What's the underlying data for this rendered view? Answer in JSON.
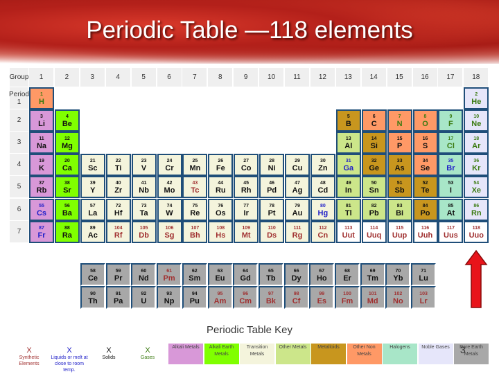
{
  "title": "Periodic Table —118 elements",
  "group_label": "Group",
  "period_label": "Period",
  "groups": [
    "1",
    "2",
    "3",
    "4",
    "5",
    "6",
    "7",
    "8",
    "9",
    "10",
    "11",
    "12",
    "13",
    "14",
    "15",
    "16",
    "17",
    "18"
  ],
  "periods": [
    "1",
    "2",
    "3",
    "4",
    "5",
    "6",
    "7"
  ],
  "colors": {
    "alkali-metal": "#d898d8",
    "alkaline-earth": "#80ff00",
    "transition": "#f4f4dc",
    "other-metal": "#cce68a",
    "metalloid": "#c8961e",
    "other-nonmetal": "#ff9966",
    "halogen": "#a8e6c8",
    "noble-gas": "#e6e6fa",
    "rare-earth": "#a8a8a8",
    "unknown": "#ffffff"
  },
  "state_colors": {
    "solid": "#111111",
    "liquid": "#2020c8",
    "gas": "#3a7a10",
    "synthetic": "#a03030"
  },
  "elements": [
    [
      1,
      "H",
      1,
      1,
      "other-nonmetal",
      "gas"
    ],
    [
      2,
      "He",
      1,
      18,
      "noble-gas",
      "gas"
    ],
    [
      3,
      "Li",
      2,
      1,
      "alkali-metal",
      "solid"
    ],
    [
      4,
      "Be",
      2,
      2,
      "alkaline-earth",
      "solid"
    ],
    [
      5,
      "B",
      2,
      13,
      "metalloid",
      "solid"
    ],
    [
      6,
      "C",
      2,
      14,
      "other-nonmetal",
      "solid"
    ],
    [
      7,
      "N",
      2,
      15,
      "other-nonmetal",
      "gas"
    ],
    [
      8,
      "O",
      2,
      16,
      "other-nonmetal",
      "gas"
    ],
    [
      9,
      "F",
      2,
      17,
      "halogen",
      "gas"
    ],
    [
      10,
      "Ne",
      2,
      18,
      "noble-gas",
      "gas"
    ],
    [
      11,
      "Na",
      3,
      1,
      "alkali-metal",
      "solid"
    ],
    [
      12,
      "Mg",
      3,
      2,
      "alkaline-earth",
      "solid"
    ],
    [
      13,
      "Al",
      3,
      13,
      "other-metal",
      "solid"
    ],
    [
      14,
      "Si",
      3,
      14,
      "metalloid",
      "solid"
    ],
    [
      15,
      "P",
      3,
      15,
      "other-nonmetal",
      "solid"
    ],
    [
      16,
      "S",
      3,
      16,
      "other-nonmetal",
      "solid"
    ],
    [
      17,
      "Cl",
      3,
      17,
      "halogen",
      "gas"
    ],
    [
      18,
      "Ar",
      3,
      18,
      "noble-gas",
      "gas"
    ],
    [
      19,
      "K",
      4,
      1,
      "alkali-metal",
      "solid"
    ],
    [
      20,
      "Ca",
      4,
      2,
      "alkaline-earth",
      "solid"
    ],
    [
      21,
      "Sc",
      4,
      3,
      "transition",
      "solid"
    ],
    [
      22,
      "Ti",
      4,
      4,
      "transition",
      "solid"
    ],
    [
      23,
      "V",
      4,
      5,
      "transition",
      "solid"
    ],
    [
      24,
      "Cr",
      4,
      6,
      "transition",
      "solid"
    ],
    [
      25,
      "Mn",
      4,
      7,
      "transition",
      "solid"
    ],
    [
      26,
      "Fe",
      4,
      8,
      "transition",
      "solid"
    ],
    [
      27,
      "Co",
      4,
      9,
      "transition",
      "solid"
    ],
    [
      28,
      "Ni",
      4,
      10,
      "transition",
      "solid"
    ],
    [
      29,
      "Cu",
      4,
      11,
      "transition",
      "solid"
    ],
    [
      30,
      "Zn",
      4,
      12,
      "transition",
      "solid"
    ],
    [
      31,
      "Ga",
      4,
      13,
      "other-metal",
      "liquid"
    ],
    [
      32,
      "Ge",
      4,
      14,
      "metalloid",
      "solid"
    ],
    [
      33,
      "As",
      4,
      15,
      "metalloid",
      "solid"
    ],
    [
      34,
      "Se",
      4,
      16,
      "other-nonmetal",
      "solid"
    ],
    [
      35,
      "Br",
      4,
      17,
      "halogen",
      "liquid"
    ],
    [
      36,
      "Kr",
      4,
      18,
      "noble-gas",
      "gas"
    ],
    [
      37,
      "Rb",
      5,
      1,
      "alkali-metal",
      "solid"
    ],
    [
      38,
      "Sr",
      5,
      2,
      "alkaline-earth",
      "solid"
    ],
    [
      39,
      "Y",
      5,
      3,
      "transition",
      "solid"
    ],
    [
      40,
      "Zr",
      5,
      4,
      "transition",
      "solid"
    ],
    [
      41,
      "Nb",
      5,
      5,
      "transition",
      "solid"
    ],
    [
      42,
      "Mo",
      5,
      6,
      "transition",
      "solid"
    ],
    [
      43,
      "Tc",
      5,
      7,
      "transition",
      "synthetic"
    ],
    [
      44,
      "Ru",
      5,
      8,
      "transition",
      "solid"
    ],
    [
      45,
      "Rh",
      5,
      9,
      "transition",
      "solid"
    ],
    [
      46,
      "Pd",
      5,
      10,
      "transition",
      "solid"
    ],
    [
      47,
      "Ag",
      5,
      11,
      "transition",
      "solid"
    ],
    [
      48,
      "Cd",
      5,
      12,
      "transition",
      "solid"
    ],
    [
      49,
      "In",
      5,
      13,
      "other-metal",
      "solid"
    ],
    [
      50,
      "Sn",
      5,
      14,
      "other-metal",
      "solid"
    ],
    [
      51,
      "Sb",
      5,
      15,
      "metalloid",
      "solid"
    ],
    [
      52,
      "Te",
      5,
      16,
      "metalloid",
      "solid"
    ],
    [
      53,
      "I",
      5,
      17,
      "halogen",
      "solid"
    ],
    [
      54,
      "Xe",
      5,
      18,
      "noble-gas",
      "gas"
    ],
    [
      55,
      "Cs",
      6,
      1,
      "alkali-metal",
      "liquid"
    ],
    [
      56,
      "Ba",
      6,
      2,
      "alkaline-earth",
      "solid"
    ],
    [
      57,
      "La",
      6,
      3,
      "transition",
      "solid"
    ],
    [
      72,
      "Hf",
      6,
      4,
      "transition",
      "solid"
    ],
    [
      73,
      "Ta",
      6,
      5,
      "transition",
      "solid"
    ],
    [
      74,
      "W",
      6,
      6,
      "transition",
      "solid"
    ],
    [
      75,
      "Re",
      6,
      7,
      "transition",
      "solid"
    ],
    [
      76,
      "Os",
      6,
      8,
      "transition",
      "solid"
    ],
    [
      77,
      "Ir",
      6,
      9,
      "transition",
      "solid"
    ],
    [
      78,
      "Pt",
      6,
      10,
      "transition",
      "solid"
    ],
    [
      79,
      "Au",
      6,
      11,
      "transition",
      "solid"
    ],
    [
      80,
      "Hg",
      6,
      12,
      "transition",
      "liquid"
    ],
    [
      81,
      "Tl",
      6,
      13,
      "other-metal",
      "solid"
    ],
    [
      82,
      "Pb",
      6,
      14,
      "other-metal",
      "solid"
    ],
    [
      83,
      "Bi",
      6,
      15,
      "other-metal",
      "solid"
    ],
    [
      84,
      "Po",
      6,
      16,
      "metalloid",
      "solid"
    ],
    [
      85,
      "At",
      6,
      17,
      "halogen",
      "solid"
    ],
    [
      86,
      "Rn",
      6,
      18,
      "noble-gas",
      "gas"
    ],
    [
      87,
      "Fr",
      7,
      1,
      "alkali-metal",
      "liquid"
    ],
    [
      88,
      "Ra",
      7,
      2,
      "alkaline-earth",
      "solid"
    ],
    [
      89,
      "Ac",
      7,
      3,
      "transition",
      "solid"
    ],
    [
      104,
      "Rf",
      7,
      4,
      "transition",
      "synthetic"
    ],
    [
      105,
      "Db",
      7,
      5,
      "transition",
      "synthetic"
    ],
    [
      106,
      "Sg",
      7,
      6,
      "transition",
      "synthetic"
    ],
    [
      107,
      "Bh",
      7,
      7,
      "transition",
      "synthetic"
    ],
    [
      108,
      "Hs",
      7,
      8,
      "transition",
      "synthetic"
    ],
    [
      109,
      "Mt",
      7,
      9,
      "transition",
      "synthetic"
    ],
    [
      110,
      "Ds",
      7,
      10,
      "transition",
      "synthetic"
    ],
    [
      111,
      "Rg",
      7,
      11,
      "transition",
      "synthetic"
    ],
    [
      112,
      "Cn",
      7,
      12,
      "transition",
      "synthetic"
    ],
    [
      113,
      "Uut",
      7,
      13,
      "unknown",
      "synthetic"
    ],
    [
      114,
      "Uuq",
      7,
      14,
      "unknown",
      "synthetic"
    ],
    [
      115,
      "Uup",
      7,
      15,
      "unknown",
      "synthetic"
    ],
    [
      116,
      "Uuh",
      7,
      16,
      "unknown",
      "synthetic"
    ],
    [
      117,
      "Uus",
      7,
      17,
      "unknown",
      "synthetic"
    ],
    [
      118,
      "Uuo",
      7,
      18,
      "unknown",
      "synthetic"
    ],
    [
      58,
      "Ce",
      8,
      3,
      "rare-earth",
      "solid"
    ],
    [
      59,
      "Pr",
      8,
      4,
      "rare-earth",
      "solid"
    ],
    [
      60,
      "Nd",
      8,
      5,
      "rare-earth",
      "solid"
    ],
    [
      61,
      "Pm",
      8,
      6,
      "rare-earth",
      "synthetic"
    ],
    [
      62,
      "Sm",
      8,
      7,
      "rare-earth",
      "solid"
    ],
    [
      63,
      "Eu",
      8,
      8,
      "rare-earth",
      "solid"
    ],
    [
      64,
      "Gd",
      8,
      9,
      "rare-earth",
      "solid"
    ],
    [
      65,
      "Tb",
      8,
      10,
      "rare-earth",
      "solid"
    ],
    [
      66,
      "Dy",
      8,
      11,
      "rare-earth",
      "solid"
    ],
    [
      67,
      "Ho",
      8,
      12,
      "rare-earth",
      "solid"
    ],
    [
      68,
      "Er",
      8,
      13,
      "rare-earth",
      "solid"
    ],
    [
      69,
      "Tm",
      8,
      14,
      "rare-earth",
      "solid"
    ],
    [
      70,
      "Yb",
      8,
      15,
      "rare-earth",
      "solid"
    ],
    [
      71,
      "Lu",
      8,
      16,
      "rare-earth",
      "solid"
    ],
    [
      90,
      "Th",
      9,
      3,
      "rare-earth",
      "solid"
    ],
    [
      91,
      "Pa",
      9,
      4,
      "rare-earth",
      "solid"
    ],
    [
      92,
      "U",
      9,
      5,
      "rare-earth",
      "solid"
    ],
    [
      93,
      "Np",
      9,
      6,
      "rare-earth",
      "solid"
    ],
    [
      94,
      "Pu",
      9,
      7,
      "rare-earth",
      "solid"
    ],
    [
      95,
      "Am",
      9,
      8,
      "rare-earth",
      "synthetic"
    ],
    [
      96,
      "Cm",
      9,
      9,
      "rare-earth",
      "synthetic"
    ],
    [
      97,
      "Bk",
      9,
      10,
      "rare-earth",
      "synthetic"
    ],
    [
      98,
      "Cf",
      9,
      11,
      "rare-earth",
      "synthetic"
    ],
    [
      99,
      "Es",
      9,
      12,
      "rare-earth",
      "synthetic"
    ],
    [
      100,
      "Fm",
      9,
      13,
      "rare-earth",
      "synthetic"
    ],
    [
      101,
      "Md",
      9,
      14,
      "rare-earth",
      "synthetic"
    ],
    [
      102,
      "No",
      9,
      15,
      "rare-earth",
      "synthetic"
    ],
    [
      103,
      "Lr",
      9,
      16,
      "rare-earth",
      "synthetic"
    ]
  ],
  "key": {
    "title": "Periodic Table Key",
    "states": [
      {
        "symbol": "X",
        "label": "Synthetic Elements",
        "state": "synthetic"
      },
      {
        "symbol": "X",
        "label": "Liquids or melt at close to room temp.",
        "state": "liquid"
      },
      {
        "symbol": "X",
        "label": "Solids",
        "state": "solid"
      },
      {
        "symbol": "X",
        "label": "Gases",
        "state": "gas"
      }
    ],
    "categories": [
      {
        "label": "Alkali Metals",
        "cat": "alkali-metal"
      },
      {
        "label": "Alkali Earth Metals",
        "cat": "alkaline-earth"
      },
      {
        "label": "Transition Metals",
        "cat": "transition"
      },
      {
        "label": "Other Metals",
        "cat": "other-metal"
      },
      {
        "label": "Metalloids",
        "cat": "metalloid"
      },
      {
        "label": "Other Non Metals",
        "cat": "other-nonmetal"
      },
      {
        "label": "Halogens",
        "cat": "halogen"
      },
      {
        "label": "Noble Gases",
        "cat": "noble-gas"
      },
      {
        "label": "Rare Earth Metals",
        "cat": "rare-earth"
      }
    ]
  },
  "slide_number": "3"
}
